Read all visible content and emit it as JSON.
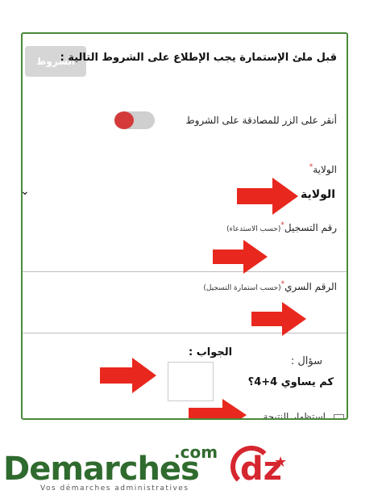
{
  "form": {
    "terms_button": "الشروط",
    "terms_text": "قبل ملئ الإستمارة يجب الإطلاع على الشروط التالية :",
    "toggle_label": "أنقر على الزر للمصادقة على الشروط",
    "toggle_on": true,
    "wilaya_label": "الولاية",
    "wilaya_value": "الولاية",
    "registration_label": "رقم التسجيل",
    "registration_hint": "(حسب الاستدعاء)",
    "secret_label": "الرقم السري",
    "secret_hint": "(حسب استمارة التسجيل)",
    "required_mark": "*",
    "question_label": "سؤال :",
    "question_text": "كم يساوي 4+4؟",
    "answer_title": "الجواب :",
    "show_result_label": "استظهار النتيجة"
  },
  "logo": {
    "main": "Demarches",
    "suffix": "dz",
    "com": ".com",
    "tagline": "Vos démarches administratives",
    "star": "★"
  },
  "colors": {
    "frame_border": "#4a8a3a",
    "arrow": "#e8281e",
    "toggle_knob": "#d43a3a",
    "logo_green": "#2f6b2e",
    "logo_red": "#d6262f"
  },
  "icons": {
    "arrow": "red-right-arrow-icon",
    "chevron": "chevron-down-icon"
  }
}
